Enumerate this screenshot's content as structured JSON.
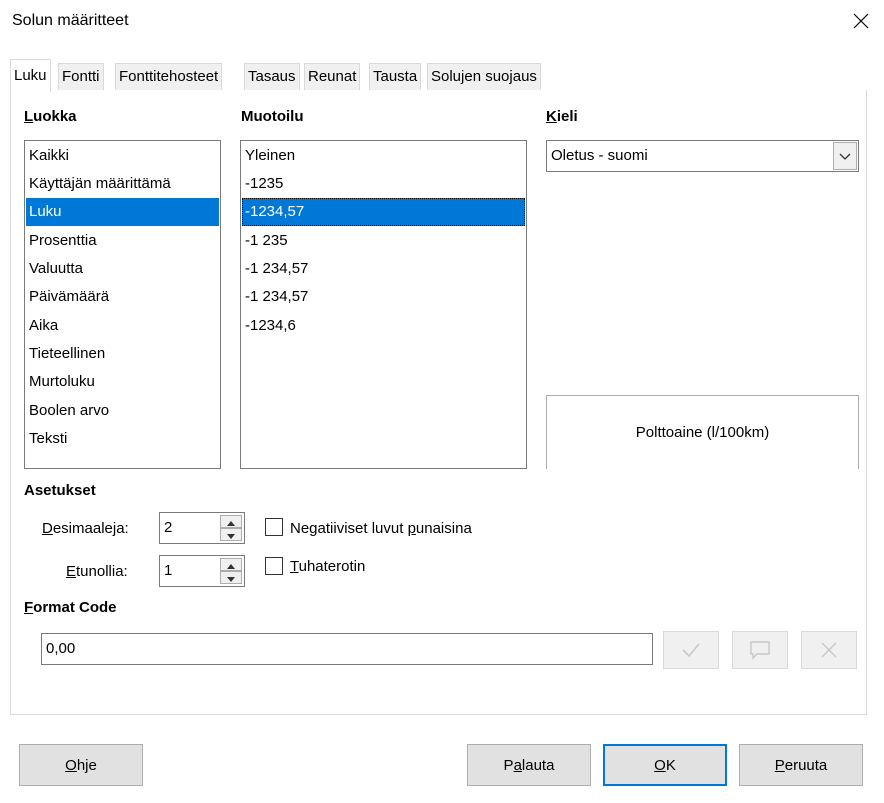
{
  "window": {
    "title": "Solun määritteet"
  },
  "tabs": [
    "Luku",
    "Fontti",
    "Fonttitehosteet",
    "Tasaus",
    "Reunat",
    "Tausta",
    "Solujen suojaus"
  ],
  "category": {
    "header_first": "L",
    "header_rest": "uokka",
    "items": [
      "Kaikki",
      "Käyttäjän määrittämä",
      "Luku",
      "Prosenttia",
      "Valuutta",
      "Päivämäärä",
      "Aika",
      "Tieteellinen",
      "Murtoluku",
      "Boolen arvo",
      "Teksti"
    ],
    "selected": "Luku"
  },
  "format": {
    "header": "Muotoilu",
    "items": [
      "Yleinen",
      "-1235",
      "-1234,57",
      "-1 235",
      "-1 234,57",
      "-1 234,57",
      "-1234,6"
    ],
    "selected": "-1234,57"
  },
  "language": {
    "header_first": "K",
    "header_rest": "ieli",
    "value": "Oletus - suomi"
  },
  "preview": {
    "text": "Polttoaine (l/100km)"
  },
  "options": {
    "header": "Asetukset",
    "decimals_first": "D",
    "decimals_rest": "esimaaleja:",
    "decimals_value": "2",
    "leading_first": "E",
    "leading_rest": "tunollia:",
    "leading_value": "1",
    "negative_red_pre": "Negatiiviset luvut ",
    "negative_red_u": "p",
    "negative_red_post": "unaisina",
    "negative_red_checked": false,
    "thousands_first": "T",
    "thousands_rest": "uhaterotin",
    "thousands_checked": false
  },
  "format_code": {
    "header_first": "F",
    "header_rest": "ormat Code",
    "value": "0,00"
  },
  "buttons": {
    "help_first": "O",
    "help_rest": "hje",
    "reset_pre": "P",
    "reset_u": "a",
    "reset_post": "lauta",
    "ok_first": "O",
    "ok_rest": "K",
    "cancel_first": "P",
    "cancel_rest": "eruuta"
  },
  "colors": {
    "selection": "#0078d7",
    "panel_bg": "#ffffff",
    "dialog_bg": "#f0f0f0"
  }
}
